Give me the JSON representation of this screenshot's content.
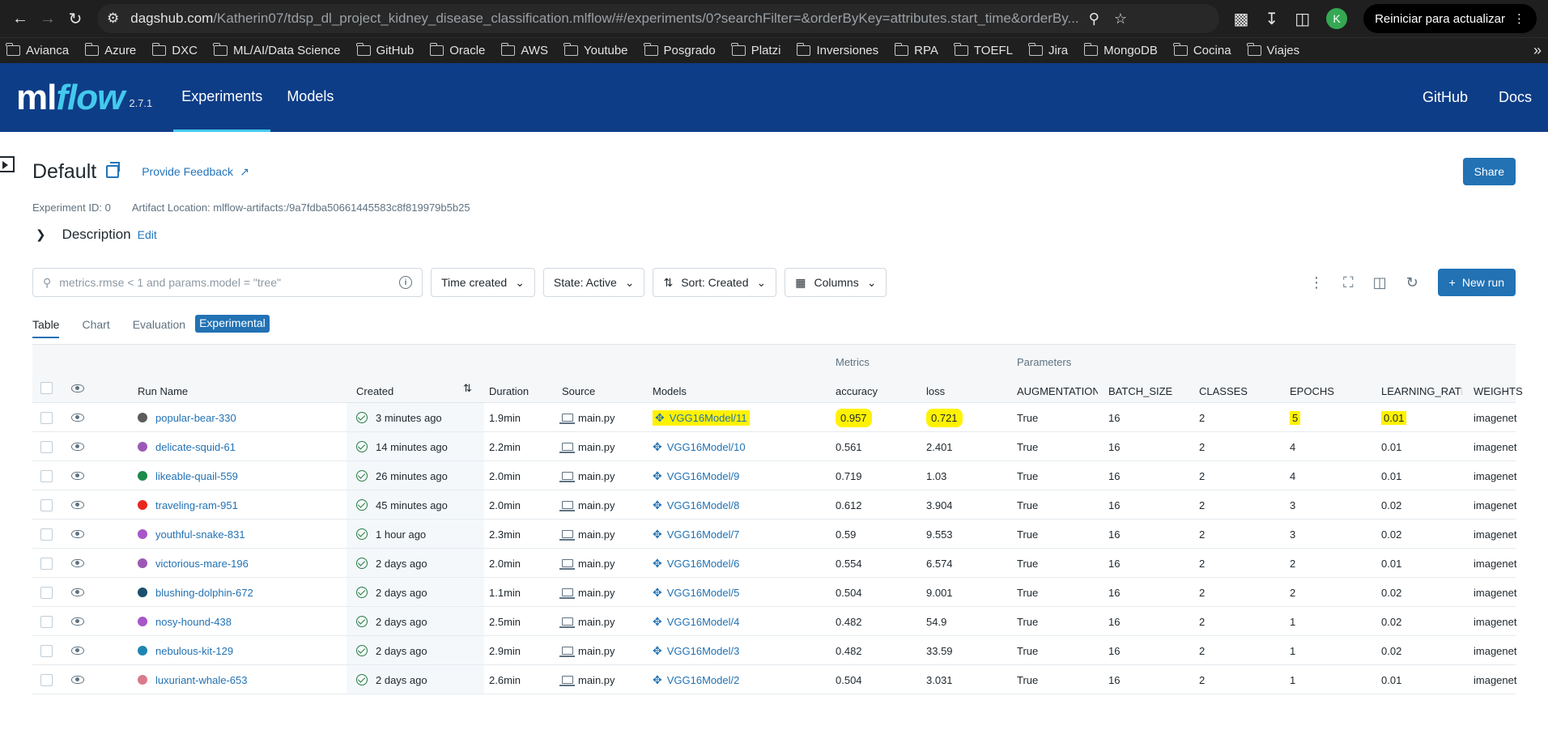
{
  "browser": {
    "url_host": "dagshub.com",
    "url_path": "/Katherin07/tdsp_dl_project_kidney_disease_classification.mlflow/#/experiments/0?searchFilter=&orderByKey=attributes.start_time&orderBy...",
    "avatar_letter": "K",
    "update_label": "Reiniciar para actualizar",
    "bookmarks": [
      "Avianca",
      "Azure",
      "DXC",
      "ML/AI/Data Science",
      "GitHub",
      "Oracle",
      "AWS",
      "Youtube",
      "Posgrado",
      "Platzi",
      "Inversiones",
      "RPA",
      "TOEFL",
      "Jira",
      "MongoDB",
      "Cocina",
      "Viajes"
    ]
  },
  "header": {
    "logo_ml": "ml",
    "logo_flow": "flow",
    "version": "2.7.1",
    "nav": [
      "Experiments",
      "Models"
    ],
    "right": [
      "GitHub",
      "Docs"
    ]
  },
  "experiment": {
    "title": "Default",
    "feedback": "Provide Feedback",
    "share": "Share",
    "experiment_id": "Experiment ID: 0",
    "artifact_location": "Artifact Location: mlflow-artifacts:/9a7fdba50661445583c8f819979b5b25",
    "description_label": "Description",
    "description_edit": "Edit"
  },
  "controls": {
    "search_placeholder": "metrics.rmse < 1 and params.model = \"tree\"",
    "time_created": "Time created",
    "state": "State: Active",
    "sort": "Sort: Created",
    "columns": "Columns",
    "new_run": "New run"
  },
  "tabs": [
    "Table",
    "Chart",
    "Evaluation",
    "Experimental"
  ],
  "table": {
    "group_metrics": "Metrics",
    "group_parameters": "Parameters",
    "headers": {
      "run_name": "Run Name",
      "created": "Created",
      "duration": "Duration",
      "source": "Source",
      "models": "Models",
      "accuracy": "accuracy",
      "loss": "loss",
      "augmentation": "AUGMENTATION",
      "batch_size": "BATCH_SIZE",
      "classes": "CLASSES",
      "epochs": "EPOCHS",
      "learning_rate": "LEARNING_RATE",
      "weights": "WEIGHTS"
    },
    "rows": [
      {
        "name": "popular-bear-330",
        "color": "#5c5c5c",
        "created": "3 minutes ago",
        "duration": "1.9min",
        "source": "main.py",
        "model": "VGG16Model/11",
        "accuracy": "0.957",
        "loss": "0.721",
        "augmentation": "True",
        "batch_size": "16",
        "classes": "2",
        "epochs": "5",
        "learning_rate": "0.01",
        "weights": "imagenet"
      },
      {
        "name": "delicate-squid-61",
        "color": "#9b59b6",
        "created": "14 minutes ago",
        "duration": "2.2min",
        "source": "main.py",
        "model": "VGG16Model/10",
        "accuracy": "0.561",
        "loss": "2.401",
        "augmentation": "True",
        "batch_size": "16",
        "classes": "2",
        "epochs": "4",
        "learning_rate": "0.01",
        "weights": "imagenet"
      },
      {
        "name": "likeable-quail-559",
        "color": "#1e8a4c",
        "created": "26 minutes ago",
        "duration": "2.0min",
        "source": "main.py",
        "model": "VGG16Model/9",
        "accuracy": "0.719",
        "loss": "1.03",
        "augmentation": "True",
        "batch_size": "16",
        "classes": "2",
        "epochs": "4",
        "learning_rate": "0.01",
        "weights": "imagenet"
      },
      {
        "name": "traveling-ram-951",
        "color": "#e8281e",
        "created": "45 minutes ago",
        "duration": "2.0min",
        "source": "main.py",
        "model": "VGG16Model/8",
        "accuracy": "0.612",
        "loss": "3.904",
        "augmentation": "True",
        "batch_size": "16",
        "classes": "2",
        "epochs": "3",
        "learning_rate": "0.02",
        "weights": "imagenet"
      },
      {
        "name": "youthful-snake-831",
        "color": "#a855c9",
        "created": "1 hour ago",
        "duration": "2.3min",
        "source": "main.py",
        "model": "VGG16Model/7",
        "accuracy": "0.59",
        "loss": "9.553",
        "augmentation": "True",
        "batch_size": "16",
        "classes": "2",
        "epochs": "3",
        "learning_rate": "0.02",
        "weights": "imagenet"
      },
      {
        "name": "victorious-mare-196",
        "color": "#9b59b6",
        "created": "2 days ago",
        "duration": "2.0min",
        "source": "main.py",
        "model": "VGG16Model/6",
        "accuracy": "0.554",
        "loss": "6.574",
        "augmentation": "True",
        "batch_size": "16",
        "classes": "2",
        "epochs": "2",
        "learning_rate": "0.01",
        "weights": "imagenet"
      },
      {
        "name": "blushing-dolphin-672",
        "color": "#1b4f6b",
        "created": "2 days ago",
        "duration": "1.1min",
        "source": "main.py",
        "model": "VGG16Model/5",
        "accuracy": "0.504",
        "loss": "9.001",
        "augmentation": "True",
        "batch_size": "16",
        "classes": "2",
        "epochs": "2",
        "learning_rate": "0.02",
        "weights": "imagenet"
      },
      {
        "name": "nosy-hound-438",
        "color": "#a855c9",
        "created": "2 days ago",
        "duration": "2.5min",
        "source": "main.py",
        "model": "VGG16Model/4",
        "accuracy": "0.482",
        "loss": "54.9",
        "augmentation": "True",
        "batch_size": "16",
        "classes": "2",
        "epochs": "1",
        "learning_rate": "0.02",
        "weights": "imagenet"
      },
      {
        "name": "nebulous-kit-129",
        "color": "#1f86b0",
        "created": "2 days ago",
        "duration": "2.9min",
        "source": "main.py",
        "model": "VGG16Model/3",
        "accuracy": "0.482",
        "loss": "33.59",
        "augmentation": "True",
        "batch_size": "16",
        "classes": "2",
        "epochs": "1",
        "learning_rate": "0.02",
        "weights": "imagenet"
      },
      {
        "name": "luxuriant-whale-653",
        "color": "#d97a8a",
        "created": "2 days ago",
        "duration": "2.6min",
        "source": "main.py",
        "model": "VGG16Model/2",
        "accuracy": "0.504",
        "loss": "3.031",
        "augmentation": "True",
        "batch_size": "16",
        "classes": "2",
        "epochs": "1",
        "learning_rate": "0.01",
        "weights": "imagenet"
      }
    ]
  }
}
